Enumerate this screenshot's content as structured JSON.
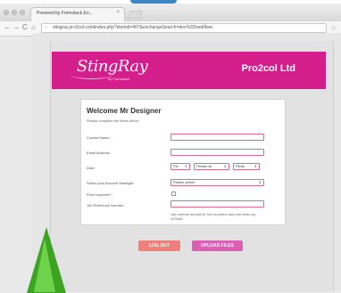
{
  "browser": {
    "tab_title": "Powered by Formstack En...",
    "tab_close": "×",
    "back": "←",
    "forward": "→",
    "reload": "C",
    "home": "⌂",
    "url": "stingray.pro2col.com/index.php?storkid=407&exchangeSearch=dev%3Dwebflare",
    "star": "☆"
  },
  "banner": {
    "logo_text": "StingRay",
    "logo_sub": "by Formstack",
    "company": "Pro2col Ltd",
    "color": "#d31e8c"
  },
  "form": {
    "welcome": "Welcome Mr Designer",
    "intro": "Please complete the fields below:",
    "fields": {
      "contact_name": "Contact Name:",
      "email": "Email Address:",
      "date": "Date:",
      "account_manager": "Select your Account Manager:",
      "proof_required": "Proof required?",
      "job_reference": "Job Reference Number:"
    },
    "date_selects": [
      "Ple",
      "Please se",
      "Pleas"
    ],
    "manager_select": "Please select",
    "hint": "Job number should be five numbers and one letter eg. 12345A"
  },
  "buttons": {
    "logout": "LOG OUT",
    "upload": "UPLOAD FILES"
  }
}
